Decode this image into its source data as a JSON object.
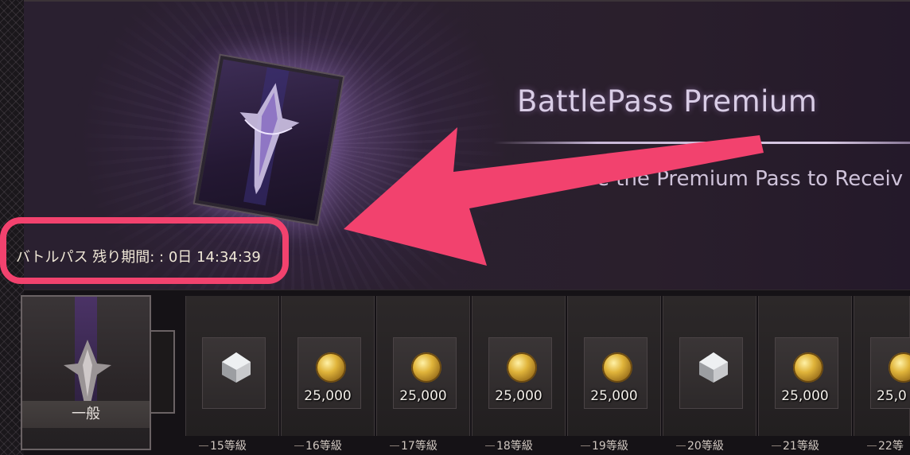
{
  "banner": {
    "title": "BattlePass Premium",
    "subtitle": "e the Premium Pass to Receiv",
    "timer_text": "バトルパス 残り期間: : 0日 14:34:39"
  },
  "colors": {
    "highlight": "#f2426e",
    "title": "#d9cde6",
    "coin": "#e0b43a"
  },
  "general_card": {
    "label": "一般"
  },
  "rewards": [
    {
      "icon": "crystal-icon",
      "amount": "",
      "level": "15等級"
    },
    {
      "icon": "gold-coin-icon",
      "amount": "25,000",
      "level": "16等級"
    },
    {
      "icon": "gold-coin-icon",
      "amount": "25,000",
      "level": "17等級"
    },
    {
      "icon": "gold-coin-icon",
      "amount": "25,000",
      "level": "18等級"
    },
    {
      "icon": "gold-coin-icon",
      "amount": "25,000",
      "level": "19等級"
    },
    {
      "icon": "crystal-icon",
      "amount": "",
      "level": "20等級"
    },
    {
      "icon": "gold-coin-icon",
      "amount": "25,000",
      "level": "21等級"
    },
    {
      "icon": "gold-coin-icon",
      "amount": "25,0",
      "level": "22等"
    }
  ]
}
